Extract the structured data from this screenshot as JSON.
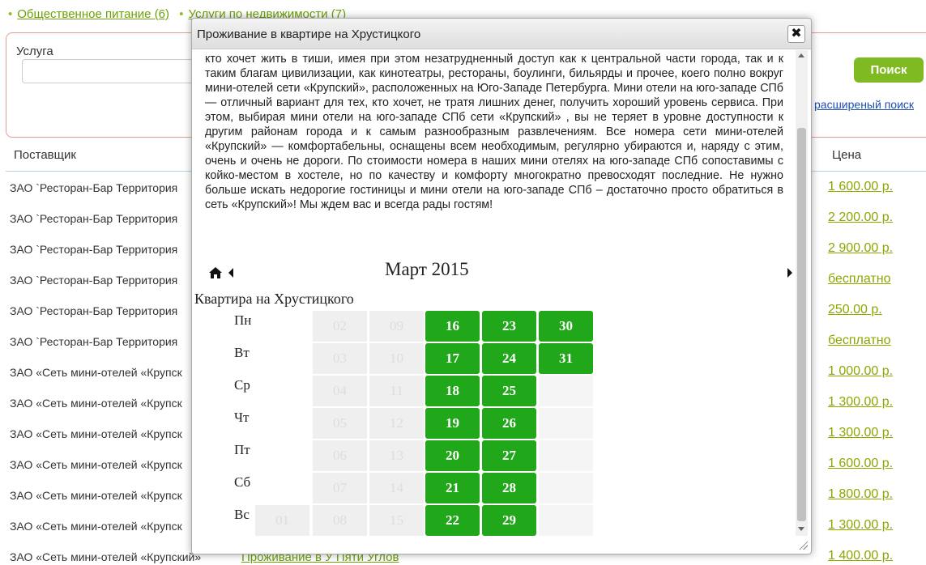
{
  "categories": [
    {
      "label": "Общественное питание (6)"
    },
    {
      "label": "Услуги по недвижимости (7)"
    }
  ],
  "search": {
    "label": "Услуга",
    "value": "",
    "button": "Поиск",
    "advanced_link": "расширеный поиск"
  },
  "table": {
    "columns": {
      "supplier": "Поставщик",
      "price": "Цена"
    },
    "rows": [
      {
        "supplier": "ЗАО `Ресторан-Бар Территория",
        "service": "",
        "price": "1 600.00 р."
      },
      {
        "supplier": "ЗАО `Ресторан-Бар Территория",
        "service": "",
        "price": "2 200.00 р."
      },
      {
        "supplier": "ЗАО `Ресторан-Бар Территория",
        "service": "",
        "price": "2 900.00 р."
      },
      {
        "supplier": "ЗАО `Ресторан-Бар Территория",
        "service": "",
        "price": "бесплатно"
      },
      {
        "supplier": "ЗАО `Ресторан-Бар Территория",
        "service": "",
        "price": "250.00 р."
      },
      {
        "supplier": "ЗАО `Ресторан-Бар Территория",
        "service": "",
        "price": "бесплатно"
      },
      {
        "supplier": "ЗАО «Сеть мини-отелей «Крупск",
        "service": "",
        "price": "1 000.00 р."
      },
      {
        "supplier": "ЗАО «Сеть мини-отелей «Крупск",
        "service": "",
        "price": "1 300.00 р."
      },
      {
        "supplier": "ЗАО «Сеть мини-отелей «Крупск",
        "service": "",
        "price": "1 300.00 р."
      },
      {
        "supplier": "ЗАО «Сеть мини-отелей «Крупск",
        "service": "",
        "price": "1 600.00 р."
      },
      {
        "supplier": "ЗАО «Сеть мини-отелей «Крупск",
        "service": "",
        "price": "1 800.00 р."
      },
      {
        "supplier": "ЗАО «Сеть мини-отелей «Крупск",
        "service": "",
        "price": "1 300.00 р."
      },
      {
        "supplier": "ЗАО «Сеть мини-отелей «Крупский»",
        "service": "Проживание в У Пяти Углов",
        "price": "1 400.00 р."
      }
    ]
  },
  "modal": {
    "title": "Проживание в квартире на Хрустицкого",
    "close_label": "✖",
    "description": "инфраструктурой тут тоже порядок, а до центра города – полчаса на метро. Это отличный район для тех, кто хочет жить в тиши, имея при этом незатрудненный доступ как к центральной части города, так и к таким благам цивилизации, как кинотеатры, рестораны, боулинги, бильярды и прочее, коего полно вокруг мини-отелей сети «Крупский», расположенных на Юго-Западе Петербурга. Мини отели на юго-западе СПб — отличный вариант для тех, кто хочет, не тратя лишних денег, получить хороший уровень сервиса. При этом, выбирая мини отели на юго-западе СПб сети «Крупский» , вы не теряет в уровне доступности к другим районам города и к самым разнообразным развлечениям. Все номера сети мини-отелей «Крупский» — комфортабельны, оснащены всем необходимым, регулярно убираются и, наряду с этим, очень и очень не дороги. По стоимости номера в наших мини отелях на юго-западе СПб сопоставимы с койко-местом в хостеле, но по качеству и комфорту многократно превосходят последние. Не нужно больше искать недорогие гостиницы и мини отели на юго-западе СПб – достаточно просто обратиться в сеть «Крупский»! Мы ждем вас и всегда рады гостям!",
    "calendar": {
      "month": "Март 2015",
      "room": "Квартира на Хрустицкого",
      "days": [
        "Пн",
        "Вт",
        "Ср",
        "Чт",
        "Пт",
        "Сб",
        "Вс"
      ],
      "rows": [
        [
          "",
          "02",
          "09",
          "16",
          "23",
          "30"
        ],
        [
          "",
          "03",
          "10",
          "17",
          "24",
          "31"
        ],
        [
          "",
          "04",
          "11",
          "18",
          "25",
          ""
        ],
        [
          "",
          "05",
          "12",
          "19",
          "26",
          ""
        ],
        [
          "",
          "06",
          "13",
          "20",
          "27",
          ""
        ],
        [
          "",
          "07",
          "14",
          "21",
          "28",
          ""
        ],
        [
          "01",
          "08",
          "15",
          "22",
          "29",
          ""
        ]
      ],
      "available": [
        "16",
        "17",
        "18",
        "19",
        "20",
        "21",
        "22",
        "23",
        "24",
        "25",
        "26",
        "27",
        "28",
        "29",
        "30",
        "31"
      ]
    }
  },
  "colors": {
    "available": "#21a71a",
    "accent": "#7fba22",
    "link": "#6ea00a",
    "price": "#8aa800"
  },
  "icons": [
    "home-icon",
    "prev-month-icon",
    "next-month-icon",
    "close-icon"
  ]
}
